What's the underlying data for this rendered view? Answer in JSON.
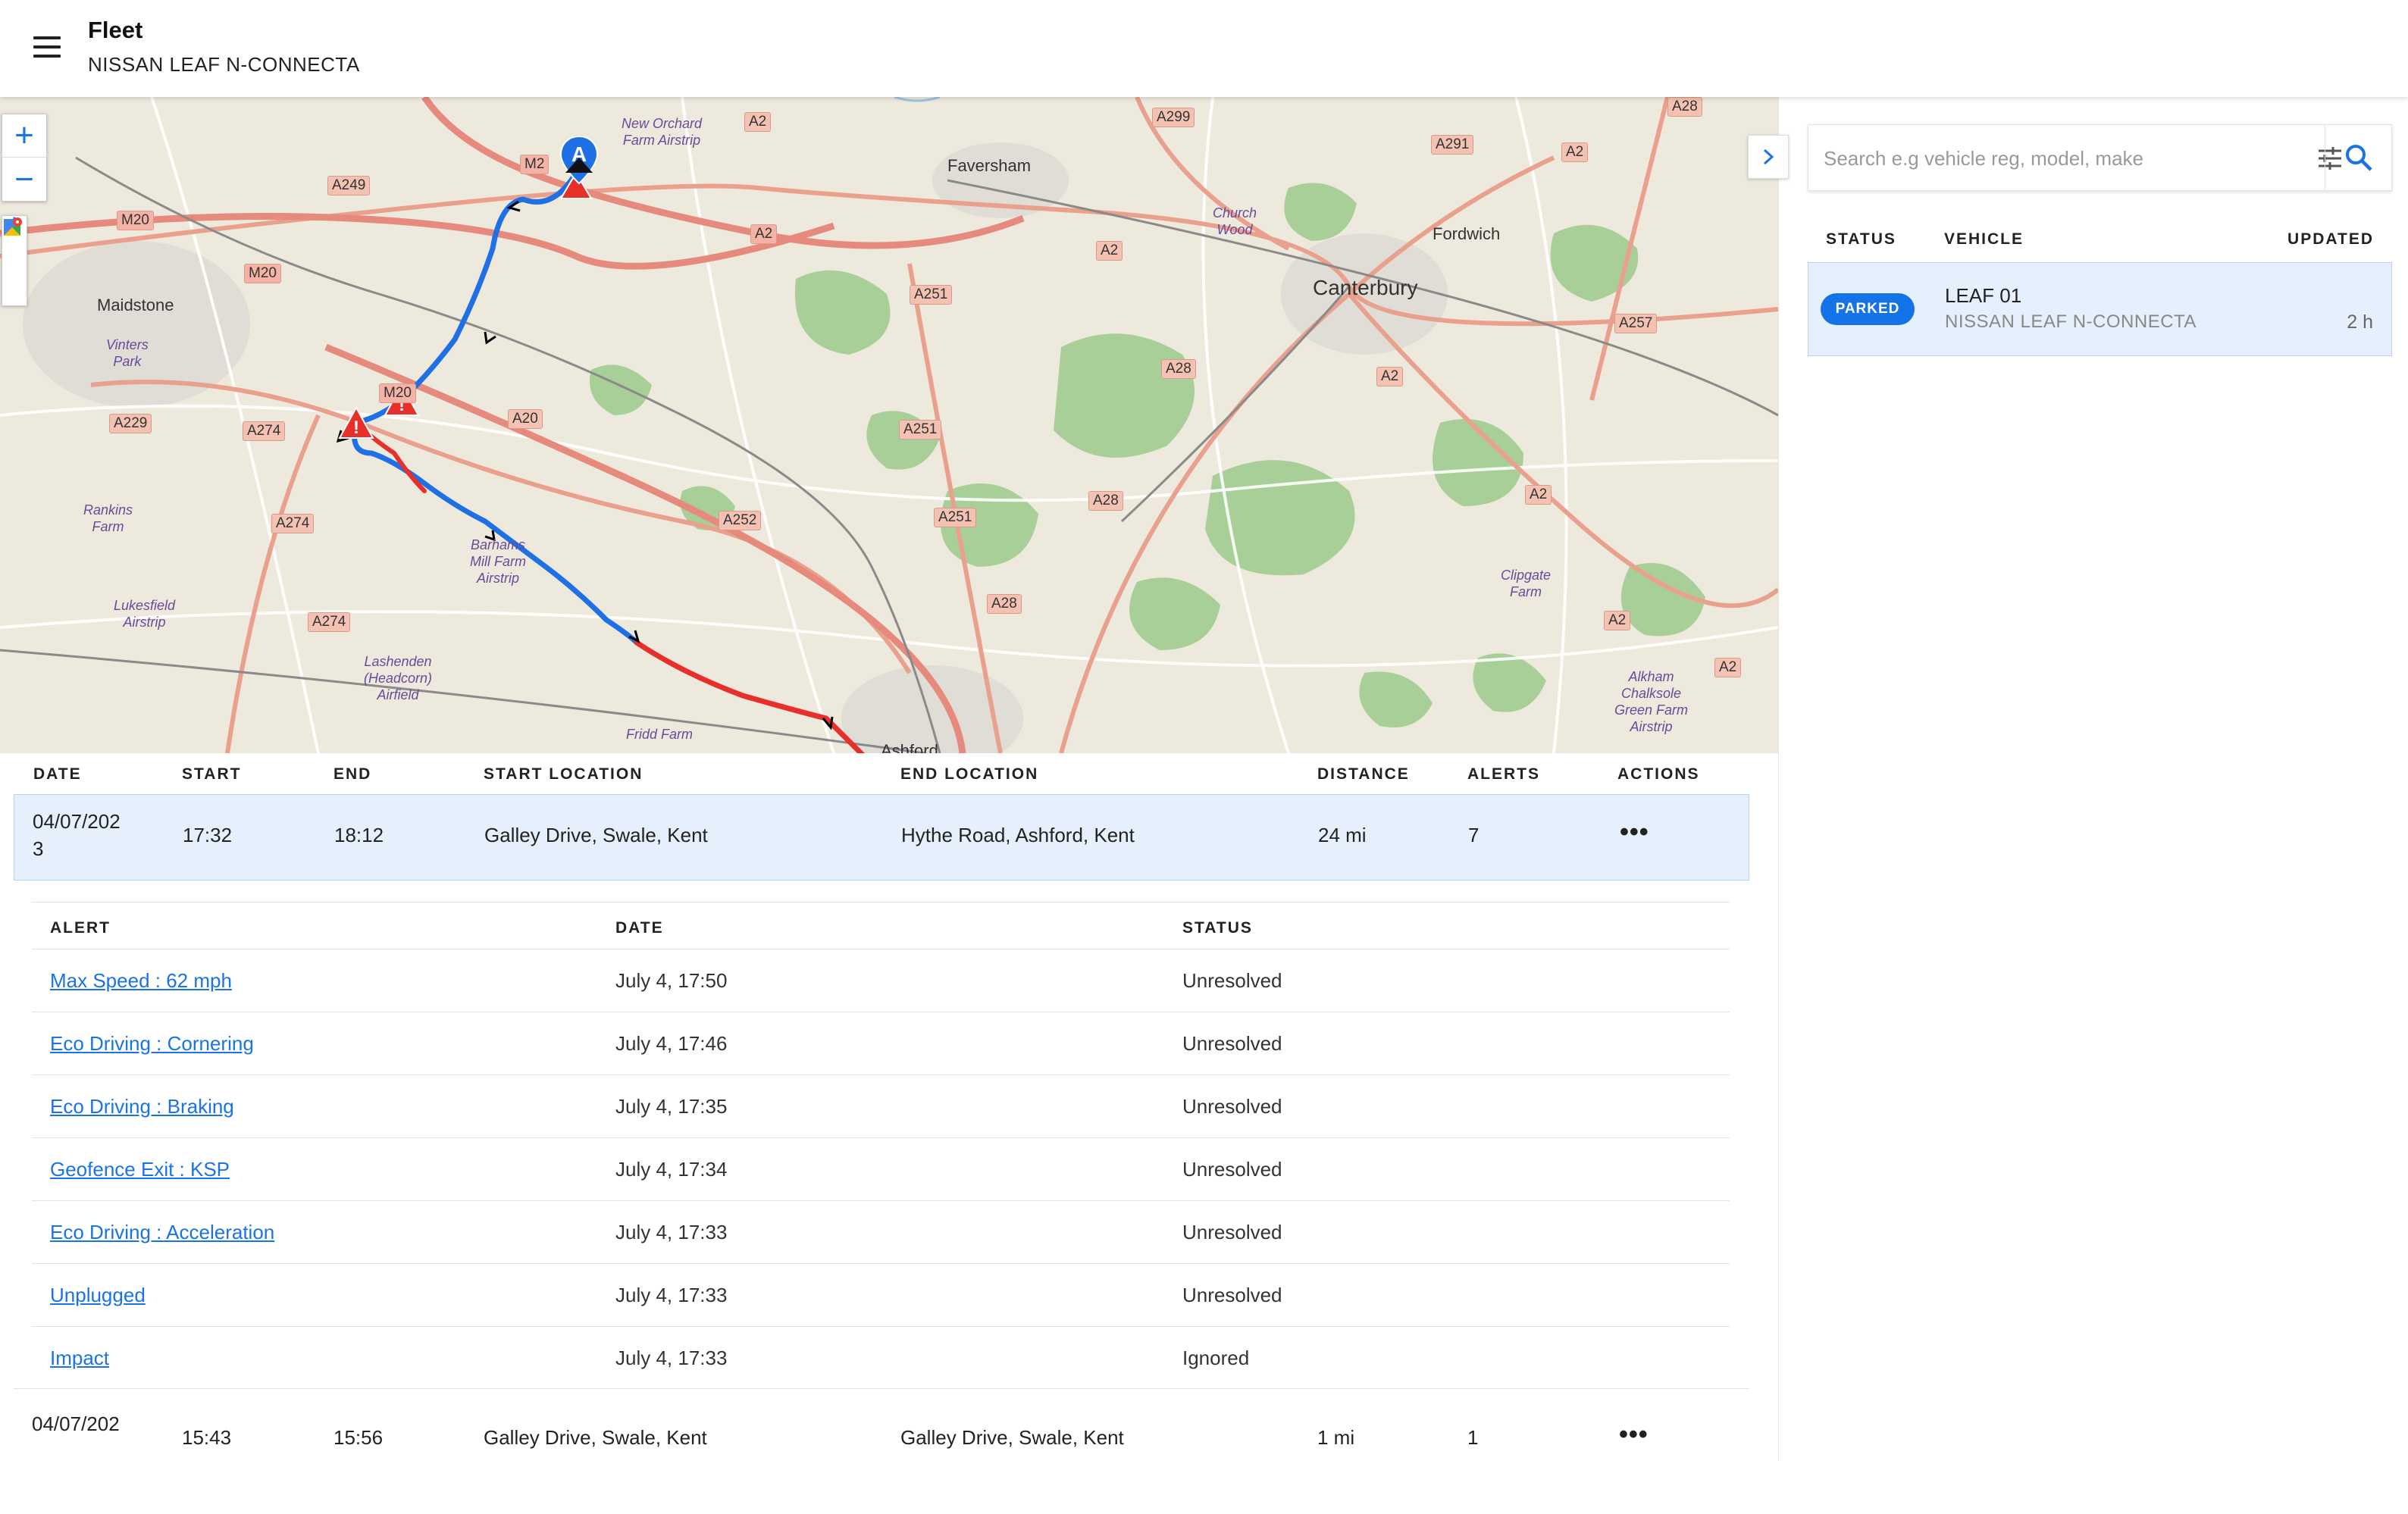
{
  "header": {
    "title": "Fleet",
    "subtitle": "NISSAN LEAF N-CONNECTA"
  },
  "map": {
    "zoom_in": "+",
    "zoom_out": "−",
    "marker_start": "A",
    "places": {
      "faversham": "Faversham",
      "maidstone": "Maidstone",
      "canterbury": "Canterbury",
      "fordwich": "Fordwich",
      "ashford": "Ashford",
      "vinters_park": "Vinters\nPark",
      "new_orchard": "New Orchard\nFarm Airstrip",
      "church_wood": "Church\nWood",
      "rankins": "Rankins\nFarm",
      "barhams": "Barhams\nMill Farm\nAirstrip",
      "lukesfield": "Lukesfield\nAirstrip",
      "lashenden": "Lashenden\n(Headcorn)\nAirfield",
      "clipgate": "Clipgate\nFarm",
      "alkham": "Alkham\nChalksole\nGreen Farm\nAirstrip",
      "fridd": "Fridd Farm"
    },
    "roads": [
      "A2",
      "A299",
      "A28",
      "A249",
      "M2",
      "M20",
      "A291",
      "M20",
      "A2",
      "A2",
      "A251",
      "A2",
      "A257",
      "A20",
      "A229",
      "A274",
      "A28",
      "A2",
      "A251",
      "A252",
      "A274",
      "A28",
      "A2",
      "A251",
      "A28",
      "A2",
      "A274",
      "A2",
      "M20"
    ]
  },
  "vehicle_panel": {
    "search_placeholder": "Search e.g vehicle reg, model, make",
    "headers": {
      "status": "STATUS",
      "vehicle": "VEHICLE",
      "updated": "UPDATED"
    },
    "vehicle": {
      "status": "PARKED",
      "name": "LEAF 01",
      "model": "NISSAN LEAF N-CONNECTA",
      "updated": "2 h"
    }
  },
  "trips": {
    "headers": {
      "date": "DATE",
      "start": "START",
      "end": "END",
      "start_location": "START LOCATION",
      "end_location": "END LOCATION",
      "distance": "DISTANCE",
      "alerts": "ALERTS",
      "actions": "ACTIONS"
    },
    "rows": [
      {
        "date_line1": "04/07/202",
        "date_line2": "3",
        "start": "17:32",
        "end": "18:12",
        "start_location": "Galley Drive, Swale, Kent",
        "end_location": "Hythe Road, Ashford, Kent",
        "distance": "24 mi",
        "alerts": "7",
        "actions": "•••"
      },
      {
        "date_line1": "04/07/202",
        "date_line2": "",
        "start": "15:43",
        "end": "15:56",
        "start_location": "Galley Drive, Swale, Kent",
        "end_location": "Galley Drive, Swale, Kent",
        "distance": "1 mi",
        "alerts": "1",
        "actions": "•••"
      }
    ],
    "alert_headers": {
      "alert": "ALERT",
      "date": "DATE",
      "status": "STATUS"
    },
    "alerts": [
      {
        "alert": "Max Speed : 62 mph",
        "date": "July 4, 17:50",
        "status": "Unresolved"
      },
      {
        "alert": "Eco Driving : Cornering",
        "date": "July 4, 17:46",
        "status": "Unresolved"
      },
      {
        "alert": "Eco Driving : Braking",
        "date": "July 4, 17:35",
        "status": "Unresolved"
      },
      {
        "alert": "Geofence Exit : KSP",
        "date": "July 4, 17:34",
        "status": "Unresolved"
      },
      {
        "alert": "Eco Driving : Acceleration",
        "date": "July 4, 17:33",
        "status": "Unresolved"
      },
      {
        "alert": "Unplugged",
        "date": "July 4, 17:33",
        "status": "Unresolved"
      },
      {
        "alert": "Impact",
        "date": "July 4, 17:33",
        "status": "Ignored"
      }
    ]
  },
  "colors": {
    "accent": "#1a73e8",
    "route_normal": "#1f6fe5",
    "route_speeding": "#e8302a",
    "parked_pill": "#1473e6",
    "selected_row": "#e6f0fc"
  }
}
